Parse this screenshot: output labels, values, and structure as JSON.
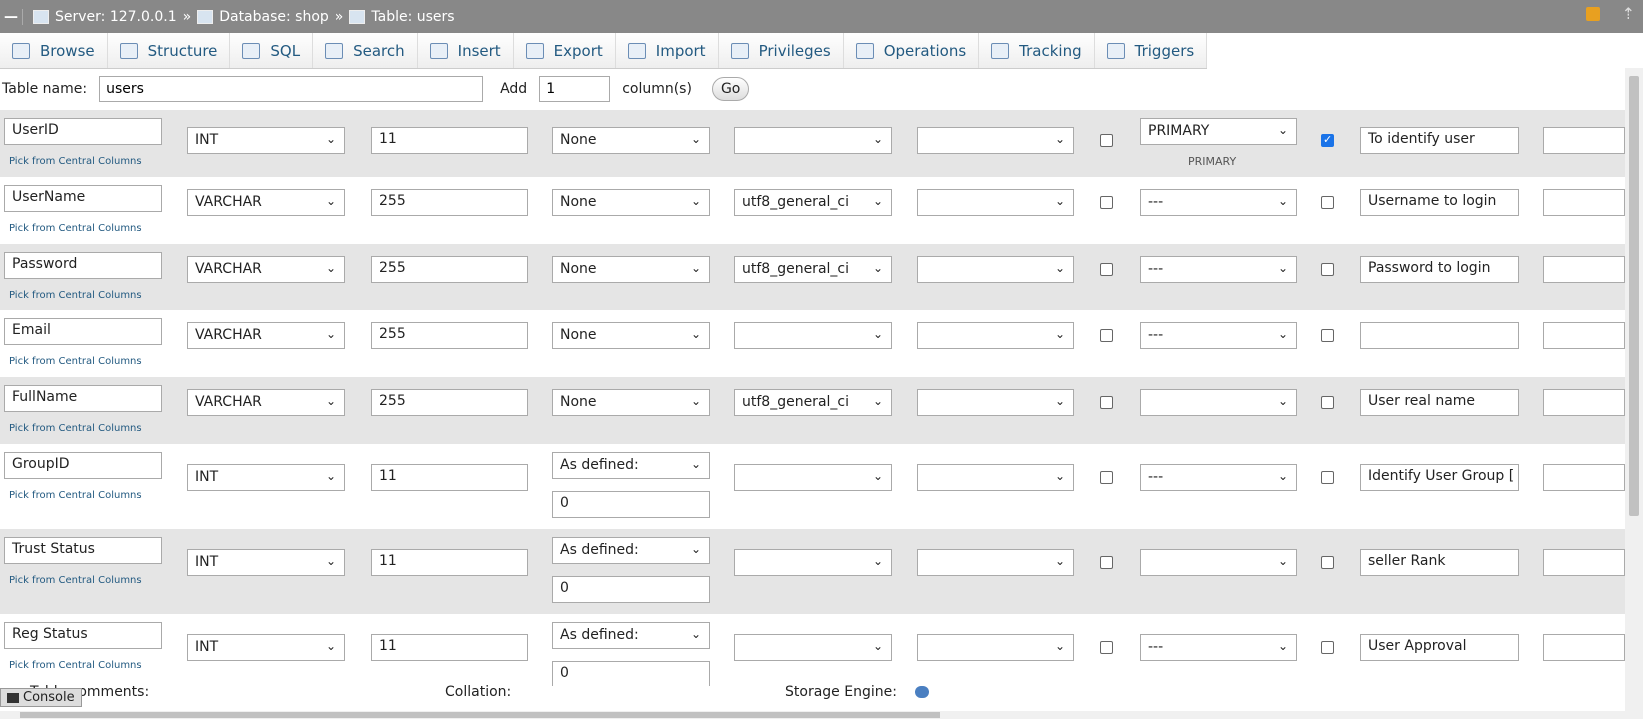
{
  "breadcrumb": {
    "server": "Server: 127.0.0.1",
    "database": "Database: shop",
    "table": "Table: users",
    "sep": "»"
  },
  "tabs": [
    {
      "label": "Browse",
      "icon": "browse-icon"
    },
    {
      "label": "Structure",
      "icon": "structure-icon"
    },
    {
      "label": "SQL",
      "icon": "sql-icon"
    },
    {
      "label": "Search",
      "icon": "search-icon"
    },
    {
      "label": "Insert",
      "icon": "insert-icon"
    },
    {
      "label": "Export",
      "icon": "export-icon"
    },
    {
      "label": "Import",
      "icon": "import-icon"
    },
    {
      "label": "Privileges",
      "icon": "privileges-icon"
    },
    {
      "label": "Operations",
      "icon": "operations-icon"
    },
    {
      "label": "Tracking",
      "icon": "tracking-icon"
    },
    {
      "label": "Triggers",
      "icon": "triggers-icon"
    }
  ],
  "table_form": {
    "name_label": "Table name:",
    "name_value": "users",
    "add_label": "Add",
    "add_value": "1",
    "columns_label": "column(s)",
    "go_label": "Go"
  },
  "pick_label": "Pick from Central Columns",
  "primary_label": "PRIMARY",
  "columns": [
    {
      "name": "UserID",
      "type": "INT",
      "length": "11",
      "default": "None",
      "collation": "",
      "attributes": "",
      "null": false,
      "index": "PRIMARY",
      "ai": true,
      "comment": "To identify user"
    },
    {
      "name": "UserName",
      "type": "VARCHAR",
      "length": "255",
      "default": "None",
      "collation": "utf8_general_ci",
      "attributes": "",
      "null": false,
      "index": "---",
      "ai": false,
      "comment": "Username to login"
    },
    {
      "name": "Password",
      "type": "VARCHAR",
      "length": "255",
      "default": "None",
      "collation": "utf8_general_ci",
      "attributes": "",
      "null": false,
      "index": "---",
      "ai": false,
      "comment": "Password to login"
    },
    {
      "name": "Email",
      "type": "VARCHAR",
      "length": "255",
      "default": "None",
      "collation": "",
      "attributes": "",
      "null": false,
      "index": "---",
      "ai": false,
      "comment": ""
    },
    {
      "name": "FullName",
      "type": "VARCHAR",
      "length": "255",
      "default": "None",
      "collation": "utf8_general_ci",
      "attributes": "",
      "null": false,
      "index": "",
      "ai": false,
      "comment": "User real name"
    },
    {
      "name": "GroupID",
      "type": "INT",
      "length": "11",
      "default": "As defined:",
      "default_value": "0",
      "collation": "",
      "attributes": "",
      "null": false,
      "index": "---",
      "ai": false,
      "comment": "Identify User Group ["
    },
    {
      "name": "Trust Status",
      "type": "INT",
      "length": "11",
      "default": "As defined:",
      "default_value": "0",
      "collation": "",
      "attributes": "",
      "null": false,
      "index": "",
      "ai": false,
      "comment": "seller Rank"
    },
    {
      "name": "Reg Status",
      "type": "INT",
      "length": "11",
      "default": "As defined:",
      "default_value": "0",
      "collation": "",
      "attributes": "",
      "null": false,
      "index": "---",
      "ai": false,
      "comment": "User Approval"
    }
  ],
  "bottom": {
    "comments_label": "Table comments:",
    "collation_label": "Collation:",
    "engine_label": "Storage Engine:",
    "console_label": "Console"
  }
}
